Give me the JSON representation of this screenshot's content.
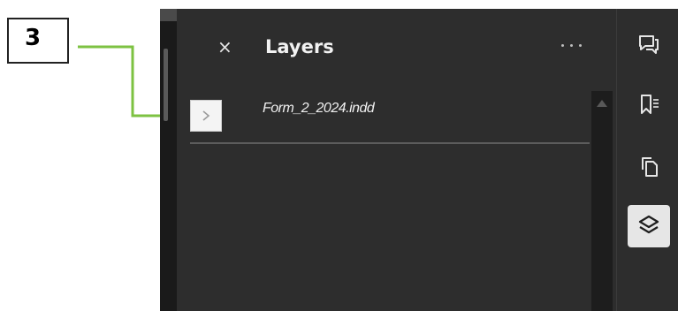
{
  "callout": {
    "number": "3",
    "arrow_color": "#7dc242"
  },
  "panel": {
    "title": "Layers",
    "close_symbol": "×",
    "more_icon": "more-horizontal-icon",
    "background": "#2d2d2d"
  },
  "layers": [
    {
      "name": "Form_2_2024.indd",
      "expand_icon": "chevron-right-icon"
    }
  ],
  "toolbar": {
    "tools": [
      {
        "name": "comments",
        "icon": "comment-icon",
        "active": false
      },
      {
        "name": "bookmarks",
        "icon": "bookmark-list-icon",
        "active": false
      },
      {
        "name": "pages",
        "icon": "copy-pages-icon",
        "active": false
      },
      {
        "name": "layers",
        "icon": "layers-icon",
        "active": true
      }
    ]
  }
}
